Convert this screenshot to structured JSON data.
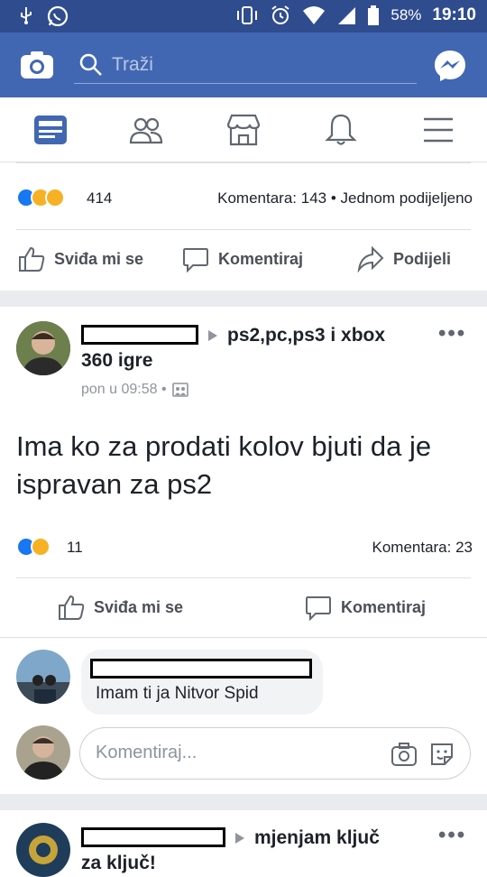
{
  "status_bar": {
    "battery": "58%",
    "time": "19:10"
  },
  "top_bar": {
    "search_placeholder": "Traži"
  },
  "post1": {
    "reaction_count": "414",
    "comments_shares": "Komentara: 143 • Jednom podijeljeno",
    "actions": {
      "like": "Sviđa mi se",
      "comment": "Komentiraj",
      "share": "Podijeli"
    }
  },
  "post2": {
    "group_line1": "ps2,pc,ps3 i xbox",
    "group_line2": "360 igre",
    "timestamp": "pon u 09:58 •",
    "text": "Ima ko za prodati kolov bjuti  da je ispravan za ps2",
    "reaction_count": "11",
    "comments": "Komentara: 23",
    "actions": {
      "like": "Sviđa mi se",
      "comment": "Komentiraj"
    },
    "top_comment": {
      "text": "Imam ti ja Nitvor Spid"
    },
    "comment_placeholder": "Komentiraj..."
  },
  "post3": {
    "group_line1": "mjenjam ključ",
    "group_line2": "za ključ!"
  },
  "colors": {
    "brand": "#4267b2",
    "status_bar": "#2f4c8e",
    "like": "#1877f2",
    "haha": "#f7b125"
  },
  "icons": [
    "camera-icon",
    "search-icon",
    "messenger-icon",
    "news-feed-icon",
    "friends-icon",
    "marketplace-icon",
    "notifications-icon",
    "menu-icon",
    "like-icon",
    "comment-icon",
    "share-icon",
    "more-icon",
    "photo-icon",
    "sticker-icon"
  ]
}
